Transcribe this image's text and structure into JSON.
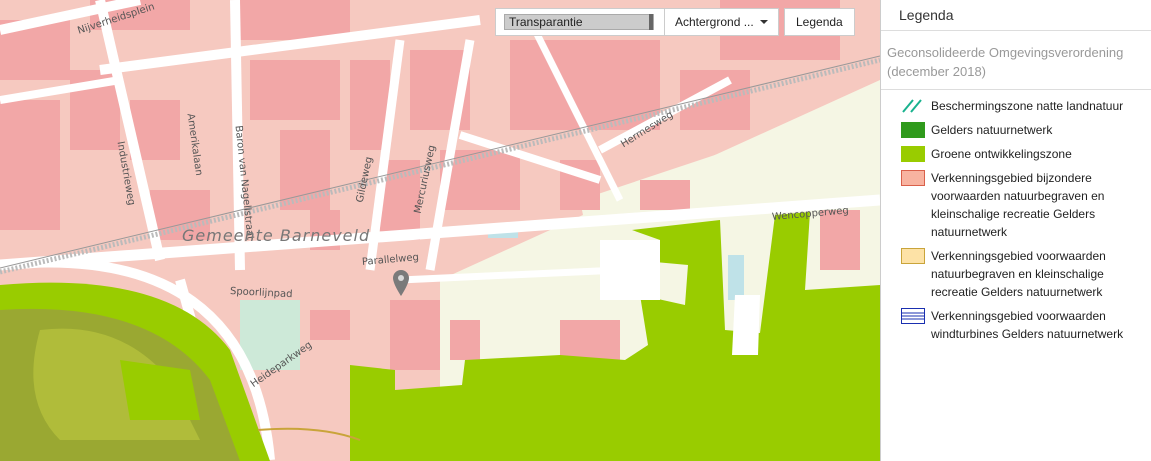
{
  "controls": {
    "transparency_label": "Transparantie",
    "background_label": "Achtergrond ...",
    "legend_button_label": "Legenda"
  },
  "map": {
    "municipality_label": "Gemeente Barneveld",
    "streets": [
      "Nijverheidsplein",
      "Industrieweg",
      "Amerikalaan",
      "Baron van Nagellstraat",
      "Gildeweg",
      "Mercuriusweg",
      "Hermesweg",
      "Wencopperweg",
      "Parallelweg",
      "Spoorlijnpad",
      "Heideparkweg"
    ],
    "colors": {
      "built_area": "#f6c9c0",
      "building": "#f2a7a7",
      "road": "#ffffff",
      "meadow": "#f5f6e4",
      "natuurnetwerk": "#2f9a1c",
      "ontwikkelingszone": "#99cc00",
      "water": "#bfe2e8"
    }
  },
  "legend": {
    "title": "Legenda",
    "subtitle": "Geconsolideerde Omgevingsverordening (december 2018)",
    "items": [
      {
        "label": "Beschermingszone natte landnatuur",
        "swatch": "hatch-teal",
        "color": "#19b28e"
      },
      {
        "label": "Gelders natuurnetwerk",
        "swatch": "solid",
        "color": "#2f9a1c"
      },
      {
        "label": "Groene ontwikkelingszone",
        "swatch": "solid",
        "color": "#99cc00"
      },
      {
        "label": "Verkenningsgebied bijzondere voorwaarden natuurbegraven en kleinschalige recreatie Gelders natuurnetwerk",
        "swatch": "solid-bordered",
        "color": "#f8b3a0",
        "border": "#d9604a"
      },
      {
        "label": "Verkenningsgebied voorwaarden natuurbegraven en kleinschalige recreatie Gelders natuurnetwerk",
        "swatch": "solid-bordered",
        "color": "#fde2a6",
        "border": "#c9a43a"
      },
      {
        "label": "Verkenningsgebied voorwaarden windturbines Gelders natuurnetwerk",
        "swatch": "lines-blue",
        "color": "#1a2fb0"
      }
    ]
  }
}
